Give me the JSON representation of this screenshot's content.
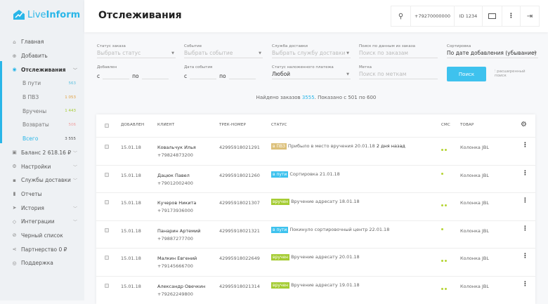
{
  "app": {
    "logo": "LiveInform",
    "logo_light": "Live",
    "logo_bold": "Inform"
  },
  "sidebar": {
    "items": [
      {
        "label": "Главная",
        "icon": "home-icon"
      },
      {
        "label": "Добавить",
        "icon": "plus-circle-icon"
      },
      {
        "label": "Отслеживания",
        "icon": "binoculars-icon",
        "active": true
      },
      {
        "label": "Баланс 2 618.16 ₽",
        "icon": "wallet-icon"
      },
      {
        "label": "Настройки",
        "icon": "gear-icon"
      },
      {
        "label": "Службы доставки",
        "icon": "truck-icon"
      },
      {
        "label": "Отчеты",
        "icon": "bar-chart-icon"
      },
      {
        "label": "История",
        "icon": "paper-plane-icon"
      },
      {
        "label": "Интеграции",
        "icon": "puzzle-icon"
      },
      {
        "label": "Черный список",
        "icon": "ban-icon"
      },
      {
        "label": "Партнерство 0 ₽",
        "icon": "share-icon"
      },
      {
        "label": "Поддержка",
        "icon": "lifebuoy-icon"
      }
    ],
    "sub": [
      {
        "label": "В пути",
        "count": "563",
        "color": "#5bc0de"
      },
      {
        "label": "В ПВЗ",
        "count": "1 053",
        "color": "#e0a040"
      },
      {
        "label": "Вручены",
        "count": "1 443",
        "color": "#a5cc33"
      },
      {
        "label": "Возвраты",
        "count": "506",
        "color": "#f0a0a0"
      },
      {
        "label": "Всего",
        "count": "3 555",
        "color": "#555"
      }
    ]
  },
  "header": {
    "title": "Отслеживания",
    "phone": "+79270000000",
    "id": "ID 1234"
  },
  "filters": {
    "status": {
      "label": "Статус заказа",
      "placeholder": "Выбрать статус"
    },
    "event": {
      "label": "Событие",
      "placeholder": "Выбрать событие"
    },
    "delivery": {
      "label": "Служба доставки",
      "placeholder": "Выбрать службу доставки"
    },
    "search": {
      "label": "Поиск по данным из заказа",
      "placeholder": "Поиск по заказам"
    },
    "sort": {
      "label": "Сортировка",
      "value": "По дате добавления (убывание)"
    },
    "added": {
      "label": "Добавлен",
      "from": "с",
      "to": "по"
    },
    "event_date": {
      "label": "Дата события",
      "from": "с",
      "to": "по"
    },
    "cod": {
      "label": "Статус наложенного платежа",
      "value": "Любой"
    },
    "tag": {
      "label": "Метка",
      "placeholder": "Поиск по меткам"
    },
    "search_button": "Поиск",
    "advanced": "расширенный поиск"
  },
  "summary": {
    "prefix": "Найдено заказов ",
    "count": "3555",
    "suffix": ". Показано с 501 по 600"
  },
  "table": {
    "headers": [
      "ДОБАВЛЕН",
      "КЛИЕНТ",
      "ТРЕК-НОМЕР",
      "СТАТУС",
      "СМС",
      "ТОВАР"
    ],
    "rows": [
      {
        "date": "15.01.18",
        "name": "Ковальчук Илья",
        "phone": "+79824873200",
        "track": "42995918021291",
        "badge": "в ПВЗ",
        "badge_color": "#dcc07a",
        "status": "Прибыло в место вручения 20.01.18",
        "extra": "2 дня назад",
        "sms": 2,
        "product": "Колонка JBL"
      },
      {
        "date": "15.01.18",
        "name": "Дацюк Павел",
        "phone": "+79012002400",
        "track": "42995918021260",
        "badge": "в пути",
        "badge_color": "#3ec2ee",
        "status": "Сортировка 21.01.18",
        "extra": "",
        "sms": 1,
        "product": "Колонка JBL"
      },
      {
        "date": "15.01.18",
        "name": "Кучеров Никита",
        "phone": "+79173936000",
        "track": "42995918021307",
        "badge": "вручен",
        "badge_color": "#a5cc33",
        "status": "Вручение адресату 18.01.18",
        "extra": "",
        "sms": 2,
        "product": "Колонка JBL"
      },
      {
        "date": "15.01.18",
        "name": "Панарин Артемий",
        "phone": "+79887277700",
        "track": "42995918021321",
        "badge": "в пути",
        "badge_color": "#3ec2ee",
        "status": "Покинуло сортировочный центр 22.01.18",
        "extra": "",
        "sms": 1,
        "product": "Колонка JBL"
      },
      {
        "date": "15.01.18",
        "name": "Малкин Евгений",
        "phone": "+79145666700",
        "track": "42995918022649",
        "badge": "вручен",
        "badge_color": "#a5cc33",
        "status": "Вручение адресату 20.01.18",
        "extra": "",
        "sms": 2,
        "product": "Колонка JBL"
      },
      {
        "date": "15.01.18",
        "name": "Александр Овечкин",
        "phone": "+79262249800",
        "track": "42995918021314",
        "badge": "вручен",
        "badge_color": "#a5cc33",
        "status": "Вручение адресату 19.01.18",
        "extra": "",
        "sms": 2,
        "product": "Колонка JBL"
      }
    ]
  }
}
